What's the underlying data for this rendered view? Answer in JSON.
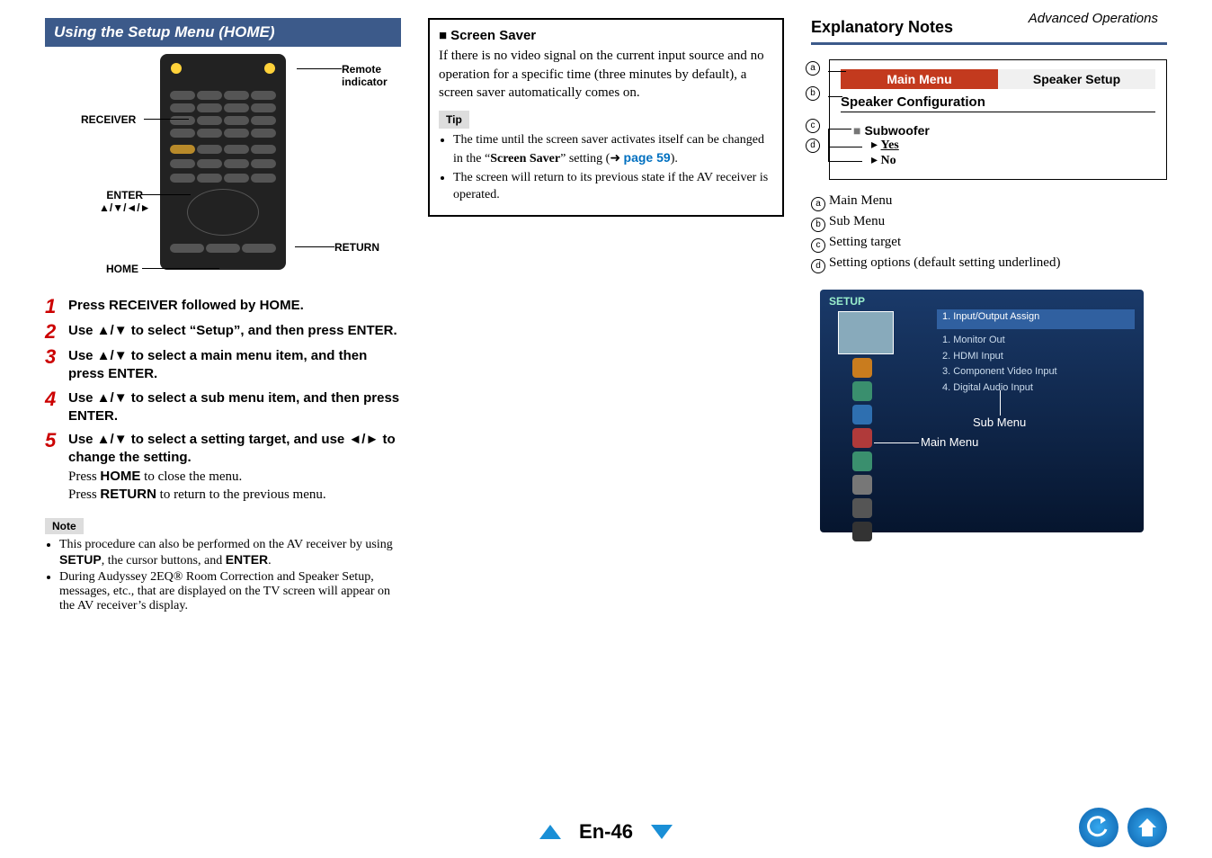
{
  "header": {
    "section": "Advanced Operations"
  },
  "col1": {
    "title": "Using the Setup Menu (HOME)",
    "remote_labels": {
      "indicator": "Remote indicator",
      "receiver": "RECEIVER",
      "enter": "ENTER\n▲/▼/◄/►",
      "home": "HOME",
      "return": "RETURN"
    },
    "steps": [
      {
        "n": "1",
        "text_before": "Press ",
        "b1": "RECEIVER",
        "mid": " followed by ",
        "b2": "HOME",
        "after": "."
      },
      {
        "n": "2",
        "text_before": "Use ▲/▼ to select “Setup”, and then press ",
        "b1": "ENTER",
        "after": "."
      },
      {
        "n": "3",
        "text_before": "Use ▲/▼ to select a main menu item, and then press ",
        "b1": "ENTER",
        "after": "."
      },
      {
        "n": "4",
        "text_before": "Use ▲/▼ to select a sub menu item, and then press ",
        "b1": "ENTER",
        "after": "."
      },
      {
        "n": "5",
        "line1_before": "Use ▲/▼ to select a setting target, and use ◄/► to change the setting.",
        "line2_before": "Press ",
        "line2_b": "HOME",
        "line2_after": " to close the menu.",
        "line3_before": "Press ",
        "line3_b": "RETURN",
        "line3_after": " to return to the previous menu."
      }
    ],
    "note_label": "Note",
    "notes": [
      "This procedure can also be performed on the AV receiver by using SETUP, the cursor buttons, and ENTER.",
      "During Audyssey 2EQ® Room Correction and Speaker Setup, messages, etc., that are displayed on the TV screen will appear on the AV receiver’s display."
    ]
  },
  "col2": {
    "h": "Screen Saver",
    "p": "If there is no video signal on the current input source and no operation for a specific time (three minutes by default), a screen saver automatically comes on.",
    "tip_label": "Tip",
    "tips_pre1": "The time until the screen saver activates itself can be changed in the “",
    "tips_b1": "Screen Saver",
    "tips_mid1": "” setting (➜ ",
    "tips_link": "page 59",
    "tips_end1": ").",
    "tip2": "The screen will return to its previous state if the AV receiver is operated."
  },
  "col3": {
    "title": "Explanatory Notes",
    "tab_main": "Main Menu",
    "tab_speaker": "Speaker Setup",
    "conf": "Speaker Configuration",
    "subw": "Subwoofer",
    "yes": "Yes",
    "no": "No",
    "list": [
      "Main Menu",
      "Sub Menu",
      "Setting target",
      "Setting options (default setting underlined)"
    ],
    "screenshot": {
      "setup": "SETUP",
      "heading": "1. Input/Output Assign",
      "items": [
        "1. Monitor Out",
        "2. HDMI Input",
        "3. Component Video Input",
        "4. Digital Audio Input"
      ],
      "callout_main": "Main Menu",
      "callout_sub": "Sub Menu"
    }
  },
  "footer": {
    "page": "En-46"
  }
}
